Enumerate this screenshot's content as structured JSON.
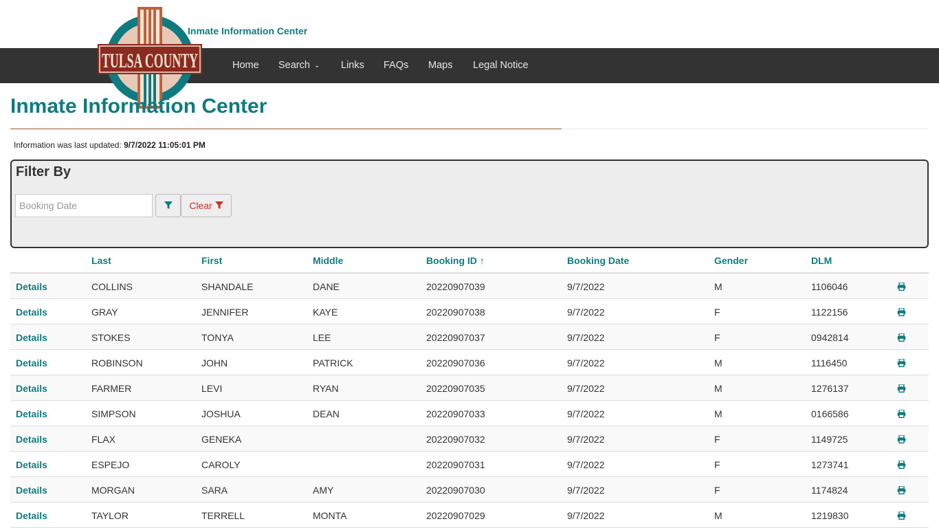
{
  "header": {
    "subtitle": "Inmate Information Center",
    "logo_text": "TULSA COUNTY"
  },
  "nav": {
    "items": [
      {
        "label": "Home"
      },
      {
        "label": "Search",
        "has_dropdown": true
      },
      {
        "label": "Links"
      },
      {
        "label": "FAQs"
      },
      {
        "label": "Maps"
      },
      {
        "label": "Legal Notice"
      }
    ]
  },
  "page": {
    "title": "Inmate Information Center",
    "updated_prefix": "Information was last updated:",
    "updated_value": "9/7/2022 11:05:01 PM"
  },
  "filter": {
    "title": "Filter By",
    "date_placeholder": "Booking Date",
    "clear_label": "Clear"
  },
  "table": {
    "columns": [
      "Last",
      "First",
      "Middle",
      "Booking ID ↑",
      "Booking Date",
      "Gender",
      "DLM"
    ],
    "details_label": "Details",
    "rows": [
      [
        "COLLINS",
        "SHANDALE",
        "DANE",
        "20220907039",
        "9/7/2022",
        "M",
        "1106046"
      ],
      [
        "GRAY",
        "JENNIFER",
        "KAYE",
        "20220907038",
        "9/7/2022",
        "F",
        "1122156"
      ],
      [
        "STOKES",
        "TONYA",
        "LEE",
        "20220907037",
        "9/7/2022",
        "F",
        "0942814"
      ],
      [
        "ROBINSON",
        "JOHN",
        "PATRICK",
        "20220907036",
        "9/7/2022",
        "M",
        "1116450"
      ],
      [
        "FARMER",
        "LEVI",
        "RYAN",
        "20220907035",
        "9/7/2022",
        "M",
        "1276137"
      ],
      [
        "SIMPSON",
        "JOSHUA",
        "DEAN",
        "20220907033",
        "9/7/2022",
        "M",
        "0166586"
      ],
      [
        "FLAX",
        "GENEKA",
        "",
        "20220907032",
        "9/7/2022",
        "F",
        "1149725"
      ],
      [
        "ESPEJO",
        "CAROLY",
        "",
        "20220907031",
        "9/7/2022",
        "F",
        "1273741"
      ],
      [
        "MORGAN",
        "SARA",
        "AMY",
        "20220907030",
        "9/7/2022",
        "F",
        "1174824"
      ],
      [
        "TAYLOR",
        "TERRELL",
        "MONTA",
        "20220907029",
        "9/7/2022",
        "M",
        "1219830"
      ]
    ]
  },
  "colors": {
    "teal": "#0f7b80",
    "navbar": "#333333",
    "rule": "#a0522d",
    "clear_red": "#c9302c"
  }
}
